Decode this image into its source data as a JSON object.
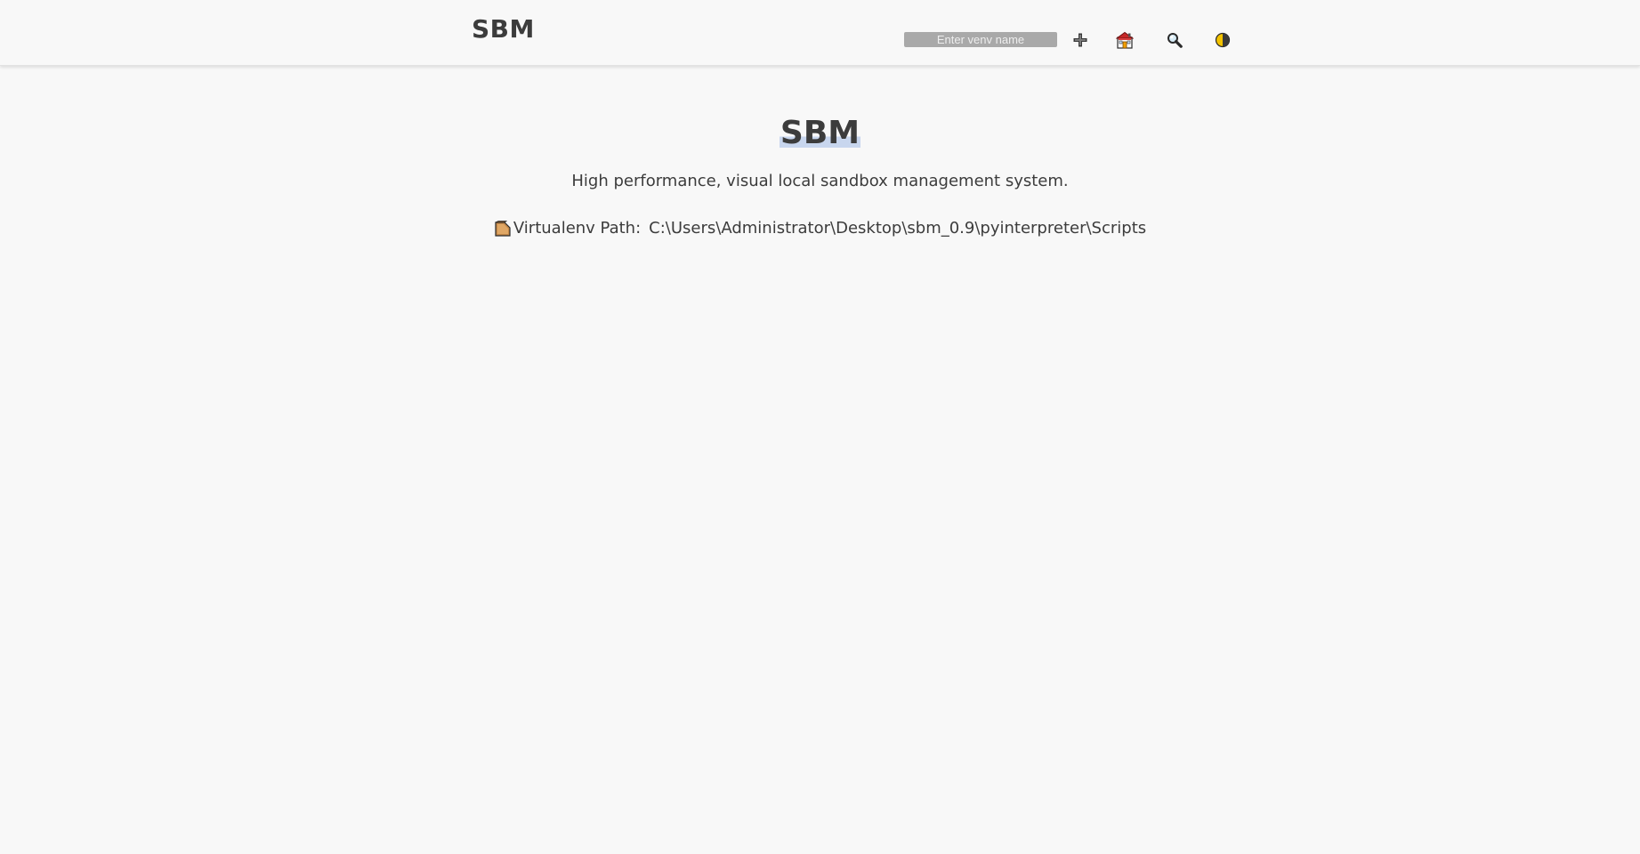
{
  "header": {
    "brand": "SBM",
    "venv_input": {
      "placeholder": "Enter venv name",
      "value": ""
    },
    "tools": [
      {
        "icon": "plus-icon"
      },
      {
        "icon": "house-icon"
      },
      {
        "icon": "search-icon"
      },
      {
        "icon": "theme-toggle-icon"
      }
    ]
  },
  "main": {
    "title": "SBM",
    "subtitle": "High performance, visual local sandbox management system.",
    "venv_path": {
      "icon": "folder-icon",
      "label": "Virtualenv Path:",
      "value": "C:\\Users\\Administrator\\Desktop\\sbm_0.9\\pyinterpreter\\Scripts"
    }
  }
}
